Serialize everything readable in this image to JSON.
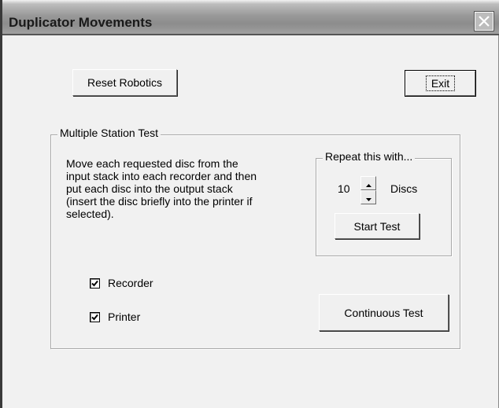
{
  "window": {
    "title": "Duplicator Movements"
  },
  "toolbar": {
    "reset_label": "Reset Robotics",
    "exit_label": "Exit"
  },
  "multiple_station_test": {
    "group_label": "Multiple Station Test",
    "description_lines": [
      "Move each requested disc from the",
      "input stack into each recorder and then",
      "put each disc into the output stack",
      "(insert the disc briefly into the printer if",
      "selected)."
    ],
    "repeat": {
      "group_label": "Repeat this with...",
      "count_value": "10",
      "unit_label": "Discs",
      "start_label": "Start Test"
    },
    "options": [
      {
        "label": "Recorder",
        "checked": true
      },
      {
        "label": "Printer",
        "checked": true
      }
    ],
    "continuous_label": "Continuous Test"
  }
}
